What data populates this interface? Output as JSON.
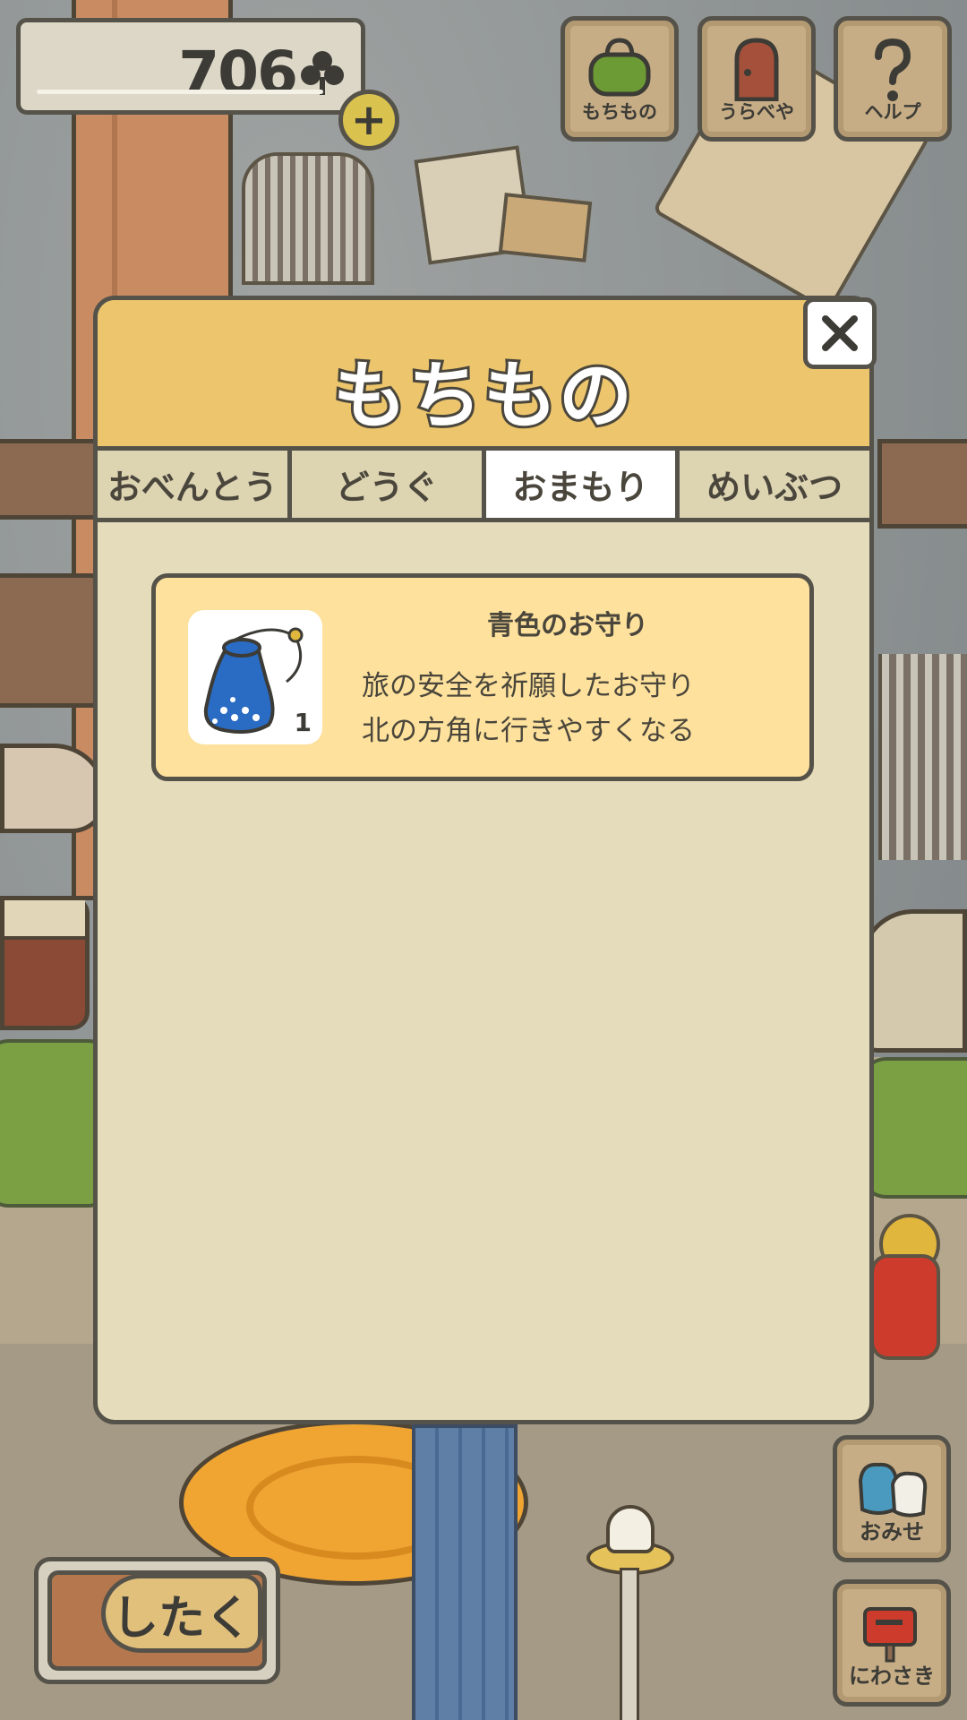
{
  "hud": {
    "clover_count": "706",
    "plus_label": "+"
  },
  "top_buttons": [
    {
      "label": "もちもの",
      "icon": "bag-icon"
    },
    {
      "label": "うらべや",
      "icon": "door-icon"
    },
    {
      "label": "ヘルプ",
      "icon": "question-icon"
    }
  ],
  "dialog": {
    "title": "もちもの",
    "close_label": "✕",
    "tabs": [
      {
        "label": "おべんとう",
        "active": false
      },
      {
        "label": "どうぐ",
        "active": false
      },
      {
        "label": "おまもり",
        "active": true
      },
      {
        "label": "めいぶつ",
        "active": false
      }
    ],
    "items": [
      {
        "name": "青色のお守り",
        "description_line1": "旅の安全を祈願したお守り",
        "description_line2": "北の方角に行きやすくなる",
        "count": "1",
        "icon": "blue-charm-pouch-icon"
      }
    ]
  },
  "bottom": {
    "shitaku_label": "したく",
    "shop_label": "おみせ",
    "garden_label": "にわさき"
  },
  "colors": {
    "header": "#ecc56d",
    "panel": "#e5dcbb",
    "card": "#fde19c",
    "outline": "#55524a",
    "charm_blue": "#2a6cc4"
  }
}
